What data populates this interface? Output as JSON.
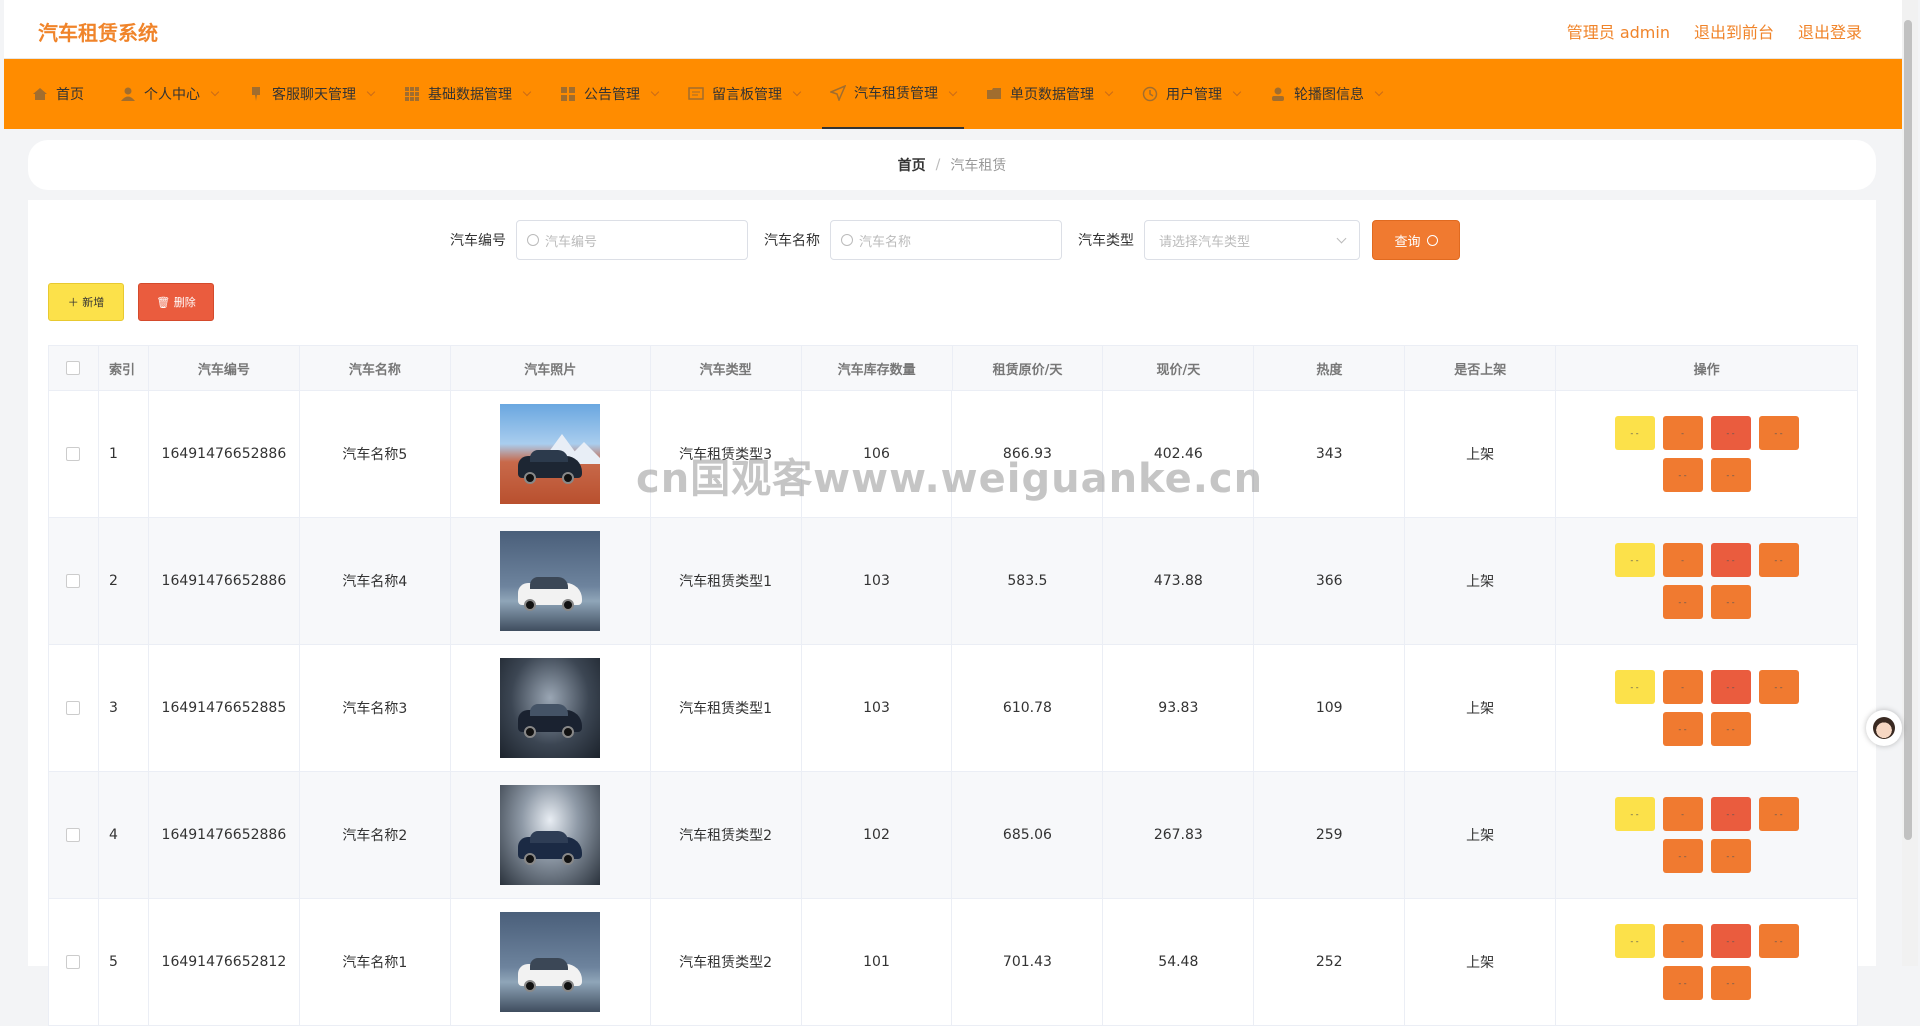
{
  "app": {
    "title": "汽车租赁系统"
  },
  "top_actions": {
    "admin": "管理员 admin",
    "to_front": "退出到前台",
    "logout": "退出登录"
  },
  "nav": [
    {
      "label": "首页",
      "icon": "home-icon"
    },
    {
      "label": "个人中心",
      "icon": "user-icon"
    },
    {
      "label": "客服聊天管理",
      "icon": "chat-icon"
    },
    {
      "label": "基础数据管理",
      "icon": "grid-icon"
    },
    {
      "label": "公告管理",
      "icon": "apps-icon"
    },
    {
      "label": "留言板管理",
      "icon": "message-icon"
    },
    {
      "label": "汽车租赁管理",
      "icon": "send-icon"
    },
    {
      "label": "单页数据管理",
      "icon": "folder-icon"
    },
    {
      "label": "用户管理",
      "icon": "clock-icon"
    },
    {
      "label": "轮播图信息",
      "icon": "person-icon"
    }
  ],
  "active_nav": "汽车租赁管理",
  "breadcrumb": {
    "home": "首页",
    "sep": "/",
    "current": "汽车租赁"
  },
  "search": {
    "code_label": "汽车编号",
    "code_placeholder": "汽车编号",
    "name_label": "汽车名称",
    "name_placeholder": "汽车名称",
    "type_label": "汽车类型",
    "type_placeholder": "请选择汽车类型",
    "query_label": "查询"
  },
  "actions": {
    "add": "＋ 新增",
    "delete": "🗑 删除"
  },
  "table": {
    "headers": [
      "索引",
      "汽车编号",
      "汽车名称",
      "汽车照片",
      "汽车类型",
      "汽车库存数量",
      "租赁原价/天",
      "现价/天",
      "热度",
      "是否上架",
      "操作"
    ],
    "rows": [
      {
        "idx": "1",
        "code": "16491476652886",
        "name": "汽车名称5",
        "type": "汽车租赁类型3",
        "stock": "106",
        "orig": "866.93",
        "now": "402.46",
        "heat": "343",
        "status": "上架"
      },
      {
        "idx": "2",
        "code": "16491476652886",
        "name": "汽车名称4",
        "type": "汽车租赁类型1",
        "stock": "103",
        "orig": "583.5",
        "now": "473.88",
        "heat": "366",
        "status": "上架"
      },
      {
        "idx": "3",
        "code": "16491476652885",
        "name": "汽车名称3",
        "type": "汽车租赁类型1",
        "stock": "103",
        "orig": "610.78",
        "now": "93.83",
        "heat": "109",
        "status": "上架"
      },
      {
        "idx": "4",
        "code": "16491476652886",
        "name": "汽车名称2",
        "type": "汽车租赁类型2",
        "stock": "102",
        "orig": "685.06",
        "now": "267.83",
        "heat": "259",
        "status": "上架"
      },
      {
        "idx": "5",
        "code": "16491476652812",
        "name": "汽车名称1",
        "type": "汽车租赁类型2",
        "stock": "101",
        "orig": "701.43",
        "now": "54.48",
        "heat": "252",
        "status": "上架"
      }
    ],
    "op_labels": [
      "- -",
      "-",
      "- -",
      "- -",
      "- -",
      "- -"
    ]
  },
  "watermark": "cn国观客www.weiguanke.cn",
  "colors": {
    "accent": "#f0842a",
    "nav_bg": "#ff8c00",
    "yellow": "#fce14a",
    "orange": "#f07a30",
    "red": "#ea5c3e"
  }
}
